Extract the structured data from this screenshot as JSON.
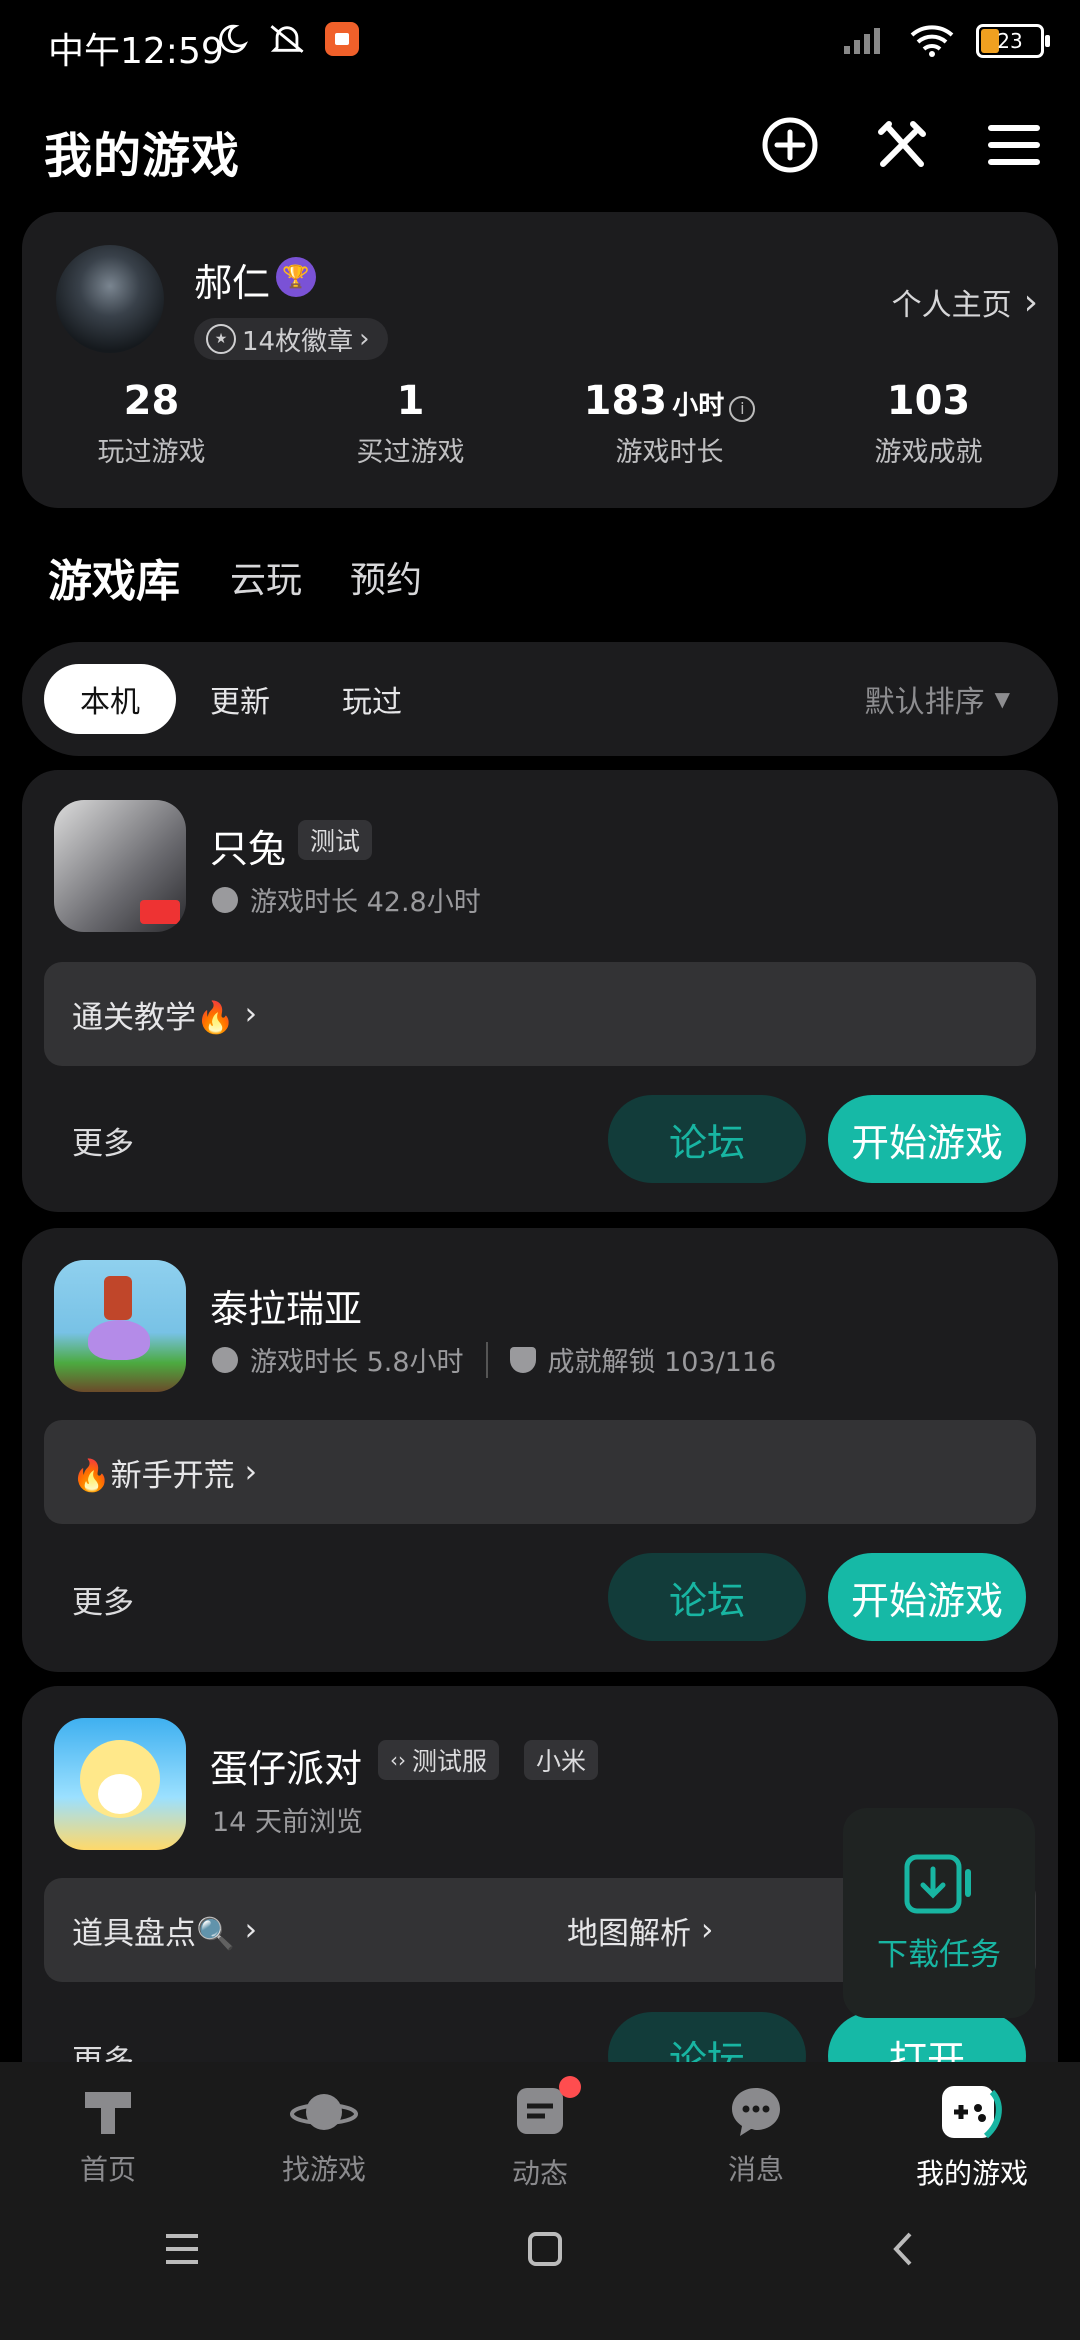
{
  "status_bar": {
    "time": "中午12:59",
    "battery": "23"
  },
  "header": {
    "title": "我的游戏"
  },
  "profile": {
    "name": "郝仁",
    "badges": "14枚徽章",
    "home_link": "个人主页",
    "stats": [
      {
        "value": "28",
        "unit": "",
        "label": "玩过游戏"
      },
      {
        "value": "1",
        "unit": "",
        "label": "买过游戏"
      },
      {
        "value": "183",
        "unit": "小时",
        "label": "游戏时长"
      },
      {
        "value": "103",
        "unit": "",
        "label": "游戏成就"
      }
    ]
  },
  "tabs": {
    "active": "游戏库",
    "items": [
      "云玩",
      "预约"
    ]
  },
  "filters": {
    "active": "本机",
    "items": [
      "更新",
      "玩过"
    ],
    "sort": "默认排序"
  },
  "games": [
    {
      "name": "只兔",
      "tag": "测试",
      "playtime": "游戏时长 42.8小时",
      "tip": "通关教学🔥",
      "more": "更多",
      "forum": "论坛",
      "action": "开始游戏"
    },
    {
      "name": "泰拉瑞亚",
      "playtime": "游戏时长 5.8小时",
      "achievement": "成就解锁 103/116",
      "tip": "🔥新手开荒",
      "more": "更多",
      "forum": "论坛",
      "action": "开始游戏"
    },
    {
      "name": "蛋仔派对",
      "tags": [
        "测试服",
        "小米"
      ],
      "browsed": "14 天前浏览",
      "tip": "道具盘点🔍",
      "tip2": "地图解析",
      "more": "更多",
      "forum": "论坛",
      "action": "打开"
    }
  ],
  "download_task": {
    "label": "下载任务"
  },
  "bottom_nav": [
    {
      "label": "首页",
      "icon": "home-icon"
    },
    {
      "label": "找游戏",
      "icon": "planet-icon"
    },
    {
      "label": "动态",
      "icon": "feed-icon"
    },
    {
      "label": "消息",
      "icon": "message-icon"
    },
    {
      "label": "我的游戏",
      "icon": "gamepad-icon"
    }
  ],
  "colors": {
    "accent": "#16b9a6",
    "card": "#1c1c1e",
    "vip": "#7a52d6"
  }
}
